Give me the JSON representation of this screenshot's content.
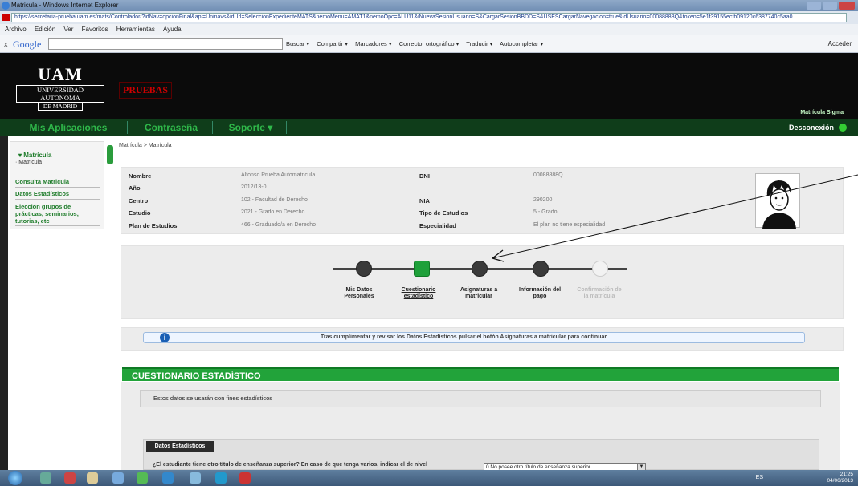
{
  "window": {
    "title": "Matricula - Windows Internet Explorer"
  },
  "address": {
    "url": "https://secretaria-prueba.uam.es/mats/Controlador/?idNav=opcionFinal&apl=Uninavs&idUrl=SeleccionExpedienteMATS&nemoMenu=AMAT1&nemoOpc=ALU11&iNuevaSesionUsuario=S&CargarSesionBBDD=S&USESCargarNavegacion=true&idUsuario=00088888Q&token=5e1f39155ecfb09120c6387740c5aa0"
  },
  "menu": {
    "items": [
      "Archivo",
      "Edición",
      "Ver",
      "Favoritos",
      "Herramientas",
      "Ayuda"
    ]
  },
  "googlebar": {
    "brand": "Google",
    "tools": [
      "Buscar ▾",
      "Compartir ▾",
      "Marcadores ▾",
      "Corrector ortográfico ▾",
      "Traducir ▾",
      "Autocompletar ▾"
    ],
    "signin": "Acceder"
  },
  "header": {
    "logo_big": "UAM",
    "logo_line1": "UNIVERSIDAD AUTONOMA",
    "logo_line2": "DE MADRID",
    "env_badge": "PRUEBAS",
    "app_name": "Matrícula Sigma"
  },
  "nav": {
    "items": [
      "Mis Aplicaciones",
      "Contraseña",
      "Soporte ▾"
    ],
    "logout": "Desconexión"
  },
  "sidebar": {
    "section": "▾ Matrícula",
    "sub": "· Matrícula",
    "links": [
      "Consulta Matricula",
      "Datos Estadísticos",
      "Elección grupos de prácticas, seminarios, tutorias, etc"
    ]
  },
  "breadcrumb": "Matrícula > Matrícula",
  "student": {
    "name_label": "Nombre",
    "name": "Alfonso Prueba Automatricula",
    "year_label": "Año",
    "year": "2012/13-0",
    "center_label": "Centro",
    "center": "102 - Facultad de Derecho",
    "study_label": "Estudio",
    "study": "2021 - Grado en Derecho",
    "plan_label": "Plan de Estudios",
    "plan": "466 - Graduado/a en Derecho",
    "dni_label": "DNI",
    "dni": "00088888Q",
    "nia_label": "NIA",
    "nia": "290200",
    "type_label": "Tipo de Estudios",
    "type": "5 - Grado",
    "spec_label": "Especialidad",
    "spec": "El plan no tiene especialidad"
  },
  "steps": [
    {
      "label": "Mis Datos Personales",
      "state": "done"
    },
    {
      "label": "Cuestionario estadístico",
      "state": "active"
    },
    {
      "label": "Asignaturas a matricular",
      "state": "done"
    },
    {
      "label": "Información del pago",
      "state": "done"
    },
    {
      "label": "Confirmación de la matrícula",
      "state": "pending"
    }
  ],
  "notice": "Tras cumplimentar y revisar los Datos Estadísticos pulsar el botón Asignaturas a matricular para continuar",
  "questionnaire": {
    "title": "CUESTIONARIO ESTADÍSTICO",
    "intro": "Estos datos se usarán con fines estadísticos",
    "section": "Datos Estadísticos",
    "question": "¿El estudiante tiene otro título de enseñanza superior? En caso de que tenga varios, indicar el de nivel",
    "answer": "0 No posee otro título de enseñanza superior"
  },
  "taskbar": {
    "lang": "ES",
    "time": "21:25",
    "date": "04/06/2013"
  },
  "colors": {
    "accent": "#22a33a",
    "nav": "#0f3d1a",
    "brand_red": "#cc0000"
  }
}
